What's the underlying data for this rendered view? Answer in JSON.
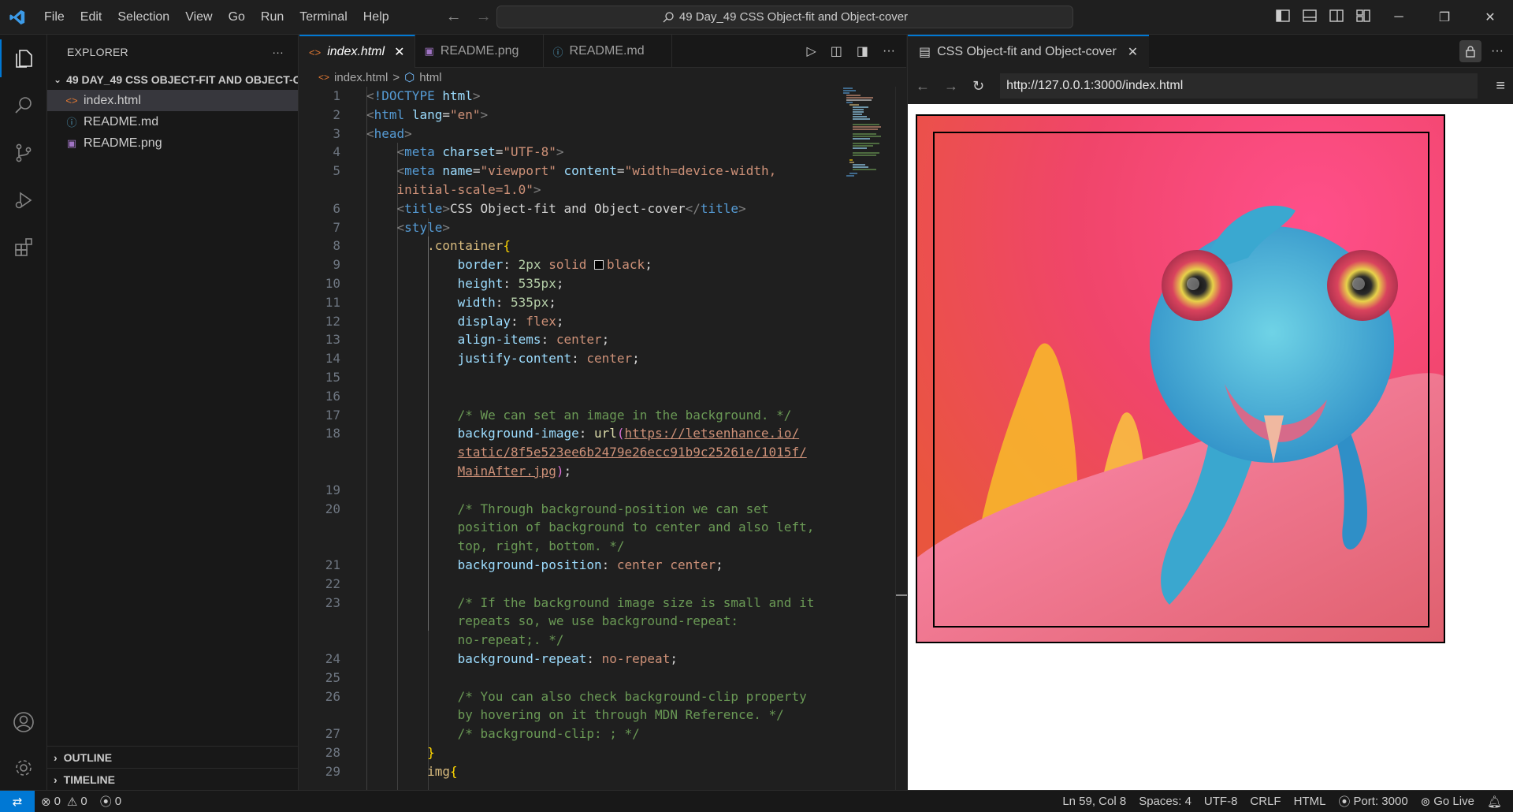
{
  "menu": [
    "File",
    "Edit",
    "Selection",
    "View",
    "Go",
    "Run",
    "Terminal",
    "Help"
  ],
  "command_center": "49 Day_49 CSS Object-fit and Object-cover",
  "explorer": {
    "title": "EXPLORER",
    "more": "···",
    "folder": "49 DAY_49 CSS OBJECT-FIT AND OBJECT-C...",
    "files": [
      {
        "name": "index.html",
        "icon": "<>",
        "color": "#e37933"
      },
      {
        "name": "README.md",
        "icon": "ⓘ",
        "color": "#519aba"
      },
      {
        "name": "README.png",
        "icon": "▣",
        "color": "#a074c4"
      }
    ],
    "outline": "OUTLINE",
    "timeline": "TIMELINE"
  },
  "tabs": [
    {
      "label": "index.html",
      "icon": "<>",
      "color": "#e37933"
    },
    {
      "label": "README.png",
      "icon": "▣",
      "color": "#a074c4"
    },
    {
      "label": "README.md",
      "icon": "ⓘ",
      "color": "#519aba"
    }
  ],
  "breadcrumb": {
    "file": "index.html",
    "sep": ">",
    "element": "html"
  },
  "line_numbers": [
    "1",
    "2",
    "3",
    "4",
    "5",
    "",
    "6",
    "7",
    "8",
    "9",
    "10",
    "11",
    "12",
    "13",
    "14",
    "15",
    "16",
    "17",
    "18",
    "",
    "",
    "19",
    "20",
    "",
    "",
    "21",
    "22",
    "23",
    "",
    "",
    "24",
    "25",
    "26",
    "",
    "27",
    "28",
    "29"
  ],
  "preview": {
    "tab_label": "CSS Object-fit and Object-cover",
    "url": "http://127.0.0.1:3000/index.html"
  },
  "status": {
    "errors": "0",
    "warnings": "0",
    "ports": "0",
    "position": "Ln 59, Col 8",
    "spaces": "Spaces: 4",
    "encoding": "UTF-8",
    "eol": "CRLF",
    "language": "HTML",
    "port": "Port: 3000",
    "golive": "Go Live"
  },
  "colors": {
    "accent": "#0078d4",
    "background": "#1f1f1f",
    "sidebar": "#181818"
  }
}
